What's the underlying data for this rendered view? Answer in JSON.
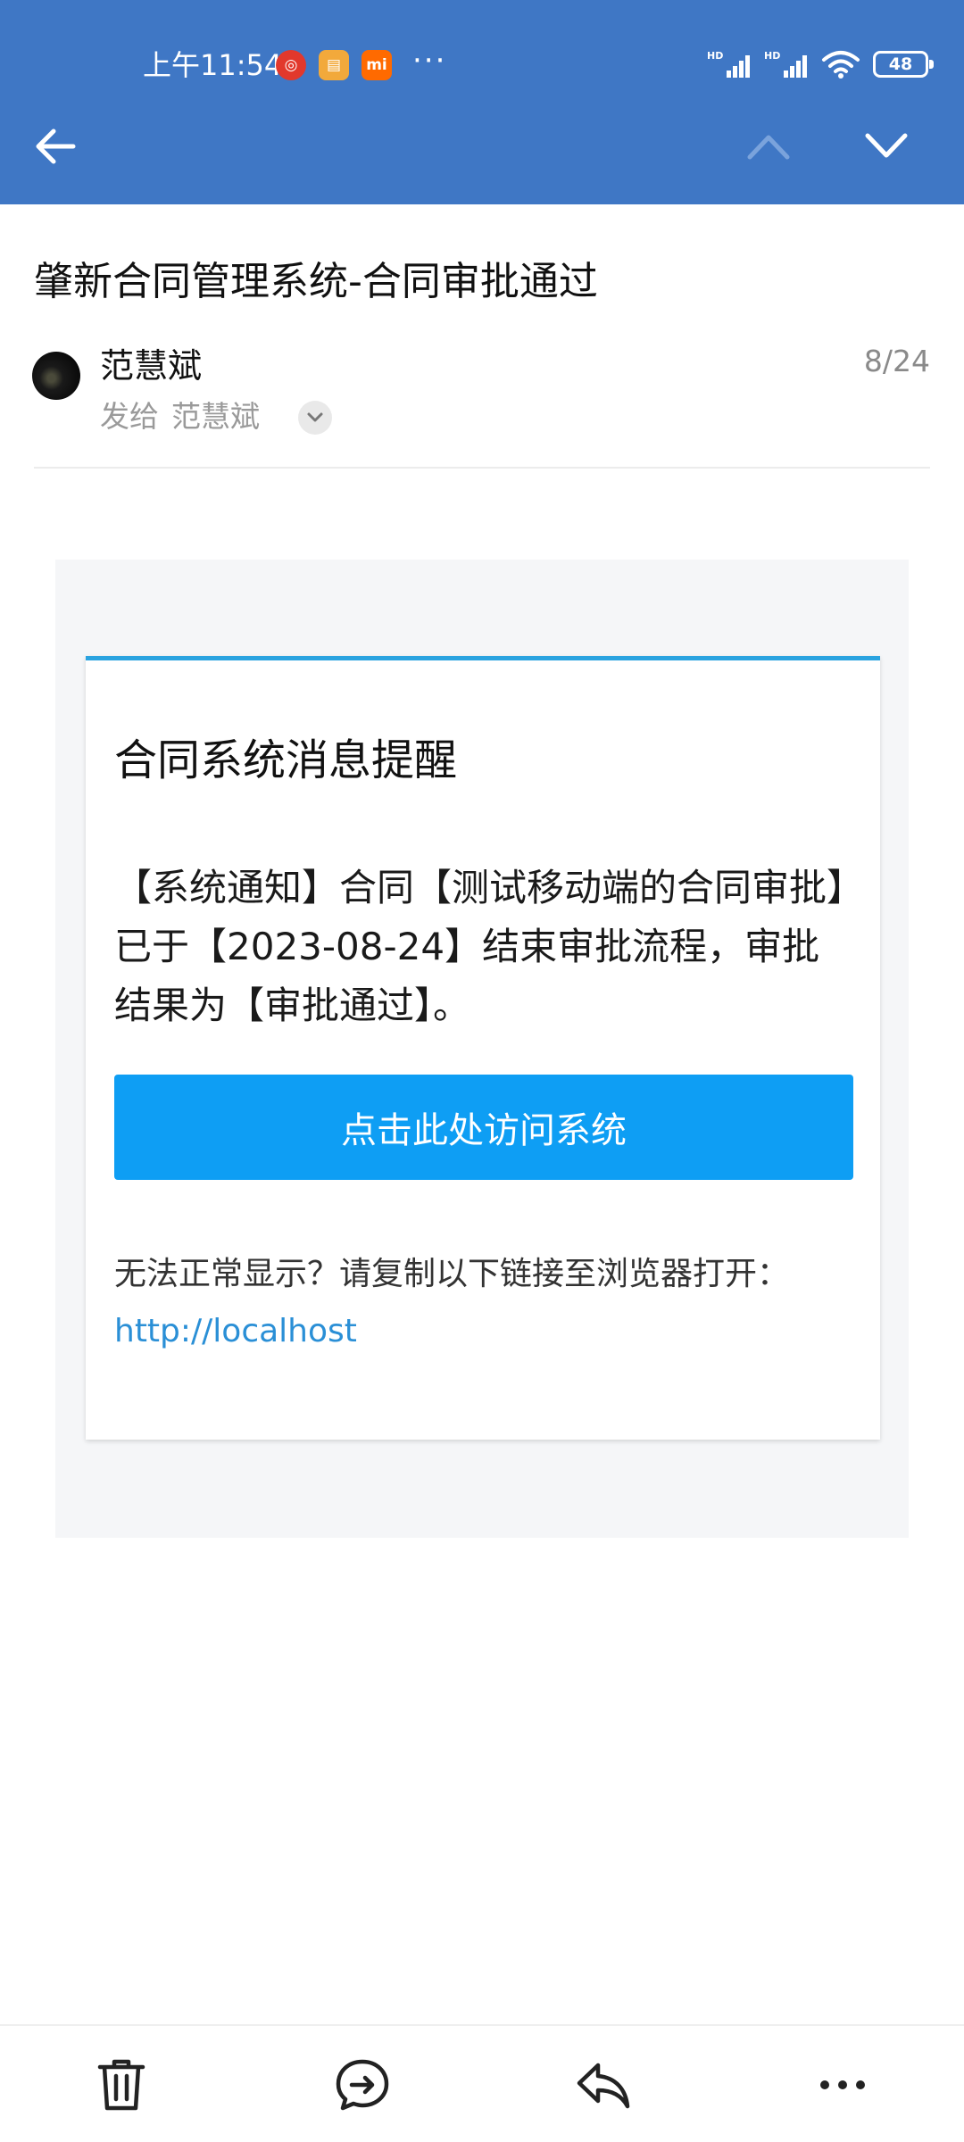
{
  "status_bar": {
    "time": "上午11:54",
    "dots": "···",
    "battery": "48",
    "app_badges": {
      "music": "◎",
      "files": "▤",
      "mi": "mi"
    }
  },
  "email": {
    "subject": "肇新合同管理系统-合同审批通过",
    "sender": "范慧斌",
    "send_to_label": "发给",
    "recipient": "范慧斌",
    "date": "8/24"
  },
  "card": {
    "title": "合同系统消息提醒",
    "text": "【系统通知】合同【测试移动端的合同审批】已于【2023-08-24】结束审批流程，审批结果为【审批通过】。",
    "button_label": "点击此处访问系统",
    "note": "无法正常显示？请复制以下链接至浏览器打开：",
    "link": "http://localhost"
  },
  "colors": {
    "header": "#3f77c5",
    "card_accent": "#2aa3e0",
    "button": "#0e9ef4",
    "link": "#2a8fd6"
  },
  "icons": {
    "back": "arrow-left-icon",
    "prev": "chevron-up-icon",
    "next": "chevron-down-icon",
    "delete": "trash-icon",
    "forward": "forward-chat-icon",
    "reply": "reply-icon",
    "more": "more-dots-icon"
  }
}
